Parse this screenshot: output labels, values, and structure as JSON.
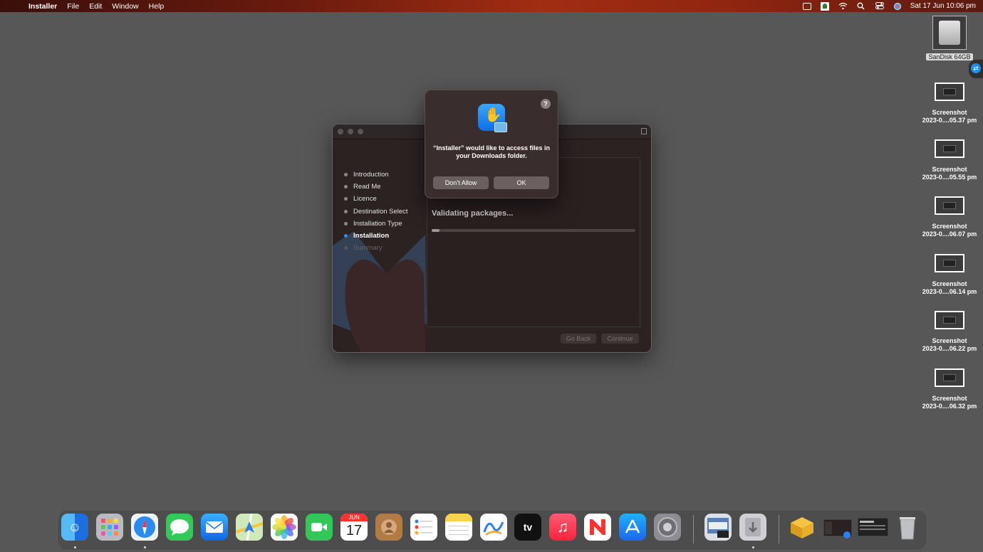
{
  "menubar": {
    "apple": "",
    "app": "Installer",
    "items": [
      "File",
      "Edit",
      "Window",
      "Help"
    ],
    "clock": "Sat 17 Jun  10:06 pm"
  },
  "desktop": {
    "drive_label": "SanDisk 64GB",
    "screenshots": [
      {
        "line1": "Screenshot",
        "line2": "2023-0....05.37 pm"
      },
      {
        "line1": "Screenshot",
        "line2": "2023-0....05.55 pm"
      },
      {
        "line1": "Screenshot",
        "line2": "2023-0....06.07 pm"
      },
      {
        "line1": "Screenshot",
        "line2": "2023-0....06.14 pm"
      },
      {
        "line1": "Screenshot",
        "line2": "2023-0....06.22 pm"
      },
      {
        "line1": "Screenshot",
        "line2": "2023-0....06.32 pm"
      }
    ]
  },
  "installer": {
    "steps": [
      "Introduction",
      "Read Me",
      "Licence",
      "Destination Select",
      "Installation Type",
      "Installation",
      "Summary"
    ],
    "status": "Validating packages...",
    "progress": 0.04,
    "go_back": "Go Back",
    "continue": "Continue"
  },
  "alert": {
    "help": "?",
    "message": "“Installer” would like to access files in your Downloads folder.",
    "dont_allow": "Don’t Allow",
    "ok": "OK"
  },
  "dock": {
    "calendar_month": "JUN",
    "calendar_day": "17",
    "tv_label": "tv"
  }
}
